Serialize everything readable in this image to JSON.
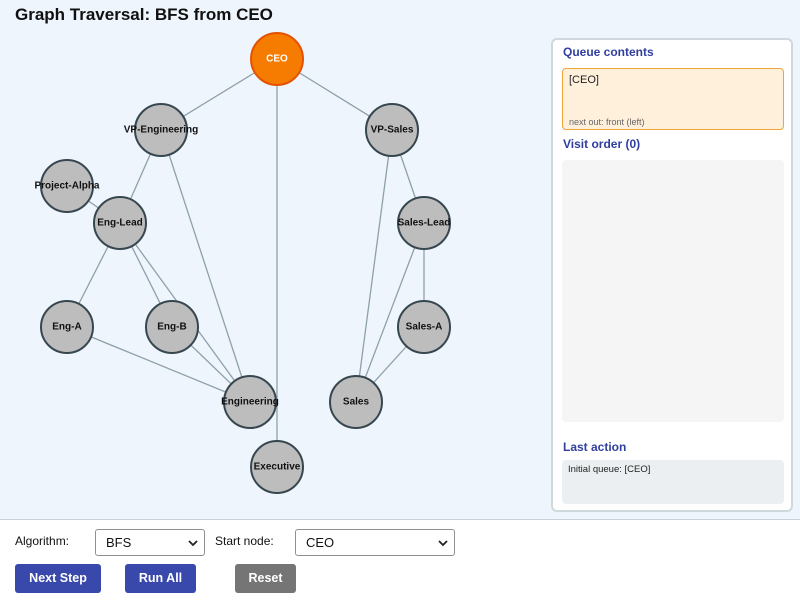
{
  "title": "Graph Traversal: BFS from CEO",
  "graph": {
    "current_node": "CEO",
    "nodes": [
      {
        "id": "CEO",
        "label": "CEO",
        "state": "current"
      },
      {
        "id": "VP-Engineering",
        "label": "VP-Engineering",
        "state": "unvisited"
      },
      {
        "id": "VP-Sales",
        "label": "VP-Sales",
        "state": "unvisited"
      },
      {
        "id": "Project-Alpha",
        "label": "Project-Alpha",
        "state": "unvisited"
      },
      {
        "id": "Eng-Lead",
        "label": "Eng-Lead",
        "state": "unvisited"
      },
      {
        "id": "Sales-Lead",
        "label": "Sales-Lead",
        "state": "unvisited"
      },
      {
        "id": "Eng-A",
        "label": "Eng-A",
        "state": "unvisited"
      },
      {
        "id": "Eng-B",
        "label": "Eng-B",
        "state": "unvisited"
      },
      {
        "id": "Sales-A",
        "label": "Sales-A",
        "state": "unvisited"
      },
      {
        "id": "Engineering",
        "label": "Engineering",
        "state": "unvisited"
      },
      {
        "id": "Sales",
        "label": "Sales",
        "state": "unvisited"
      },
      {
        "id": "Executive",
        "label": "Executive",
        "state": "unvisited"
      }
    ],
    "edges": [
      [
        "CEO",
        "VP-Engineering"
      ],
      [
        "CEO",
        "VP-Sales"
      ],
      [
        "CEO",
        "Executive"
      ],
      [
        "VP-Engineering",
        "Eng-Lead"
      ],
      [
        "VP-Engineering",
        "Engineering"
      ],
      [
        "VP-Sales",
        "Sales-Lead"
      ],
      [
        "VP-Sales",
        "Sales"
      ],
      [
        "Project-Alpha",
        "Eng-Lead"
      ],
      [
        "Eng-Lead",
        "Eng-A"
      ],
      [
        "Eng-Lead",
        "Eng-B"
      ],
      [
        "Eng-Lead",
        "Engineering"
      ],
      [
        "Eng-A",
        "Engineering"
      ],
      [
        "Eng-B",
        "Engineering"
      ],
      [
        "Sales-Lead",
        "Sales-A"
      ],
      [
        "Sales-Lead",
        "Sales"
      ],
      [
        "Sales-A",
        "Sales"
      ]
    ]
  },
  "panel": {
    "queue_heading": "Queue contents",
    "queue_value": "[CEO]",
    "queue_hint": "next out: front (left)",
    "visit_heading": "Visit order (0)",
    "visit_items": [],
    "action_heading": "Last action",
    "action_text": "Initial queue: [CEO]"
  },
  "controls": {
    "algorithm_label": "Algorithm:",
    "algorithm_value": "BFS",
    "start_label": "Start node:",
    "start_value": "CEO",
    "next_step_label": "Next Step",
    "run_all_label": "Run All",
    "reset_label": "Reset"
  },
  "colors": {
    "current_node": "#f57c00",
    "unvisited_node": "#bdbdbd",
    "edge": "#8fa0ab",
    "primary_button": "#3949ab",
    "reset_button": "#757575",
    "heading": "#303f9f",
    "queue_background": "#fff0dc"
  }
}
